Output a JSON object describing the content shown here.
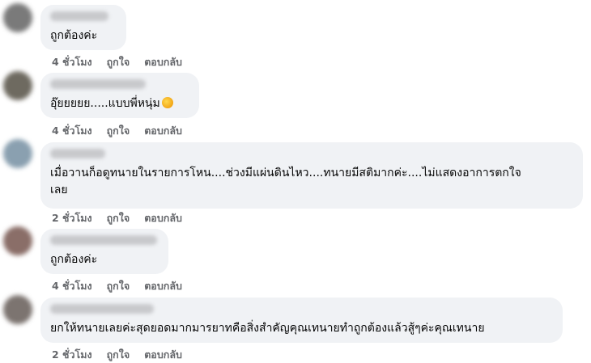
{
  "comments": [
    {
      "text": "ถูกต้องค่ะ",
      "time": "4 ชั่วโมง",
      "like": "ถูกใจ",
      "reply": "ตอบกลับ",
      "avatar_color": "#7a7a7a"
    },
    {
      "text": "อุ๊ยยยยย.....แบบพี่หนุ่ม",
      "emoji": "rolling-on-floor-laughing-emoji",
      "time": "4 ชั่วโมง",
      "like": "ถูกใจ",
      "reply": "ตอบกลับ",
      "avatar_color": "#6e6a60"
    },
    {
      "text": "เมื่อวานก็อดูทนายในรายการโหน....ช่วงมีแผ่นดินไหว....ทนายมีสติมากค่ะ....ไม่แสดงอาการตกใจ\nเลย",
      "time": "2 ชั่วโมง",
      "like": "ถูกใจ",
      "reply": "ตอบกลับ",
      "avatar_color": "#8aa0b0"
    },
    {
      "text": "ถูกต้องค่ะ",
      "time": "4 ชั่วโมง",
      "like": "ถูกใจ",
      "reply": "ตอบกลับ",
      "avatar_color": "#8a6e68"
    },
    {
      "text": "ยกให้ทนายเลยค่ะสุดยอดมากมารยาทคือสิ่งสำคัญคุณเทนายทำถูกต้องแล้วสู้ๆค่ะคุณเทนาย",
      "time": "2 ชั่วโมง",
      "like": "ถูกใจ",
      "reply": "ตอบกลับ",
      "avatar_color": "#7c7470"
    }
  ]
}
